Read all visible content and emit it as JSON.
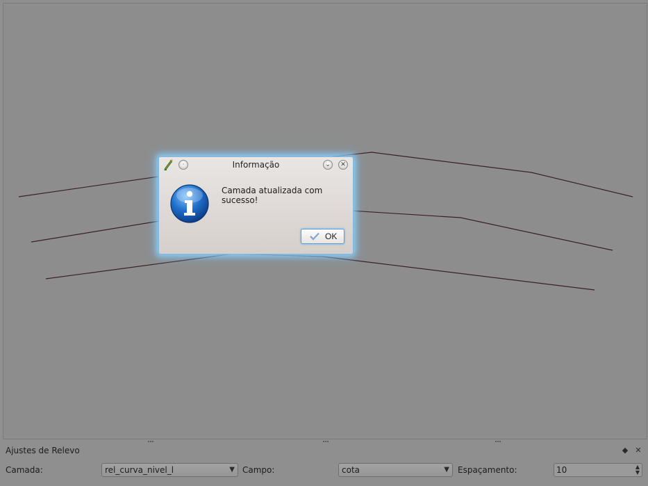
{
  "dialog": {
    "title": "Informação",
    "message": "Camada atualizada com sucesso!",
    "ok_label": "OK"
  },
  "dock": {
    "title": "Ajustes de Relevo",
    "camada_label": "Camada:",
    "camada_value": "rel_curva_nivel_l",
    "campo_label": "Campo:",
    "campo_value": "cota",
    "espacamento_label": "Espaçamento:",
    "espacamento_value": "10"
  },
  "icons": {
    "dialog_app": "qgis-icon",
    "dialog_menu": "window-menu-icon",
    "dialog_minimize": "minimize-icon",
    "dialog_close": "close-icon",
    "message_type": "information-icon",
    "ok": "checkmark-icon",
    "dock_float": "float-icon",
    "dock_close": "close-icon"
  },
  "colors": {
    "dialog_glow": "#8cd2ff",
    "contour_line": "#3a1f2a",
    "info_icon": "#1a63b8"
  }
}
